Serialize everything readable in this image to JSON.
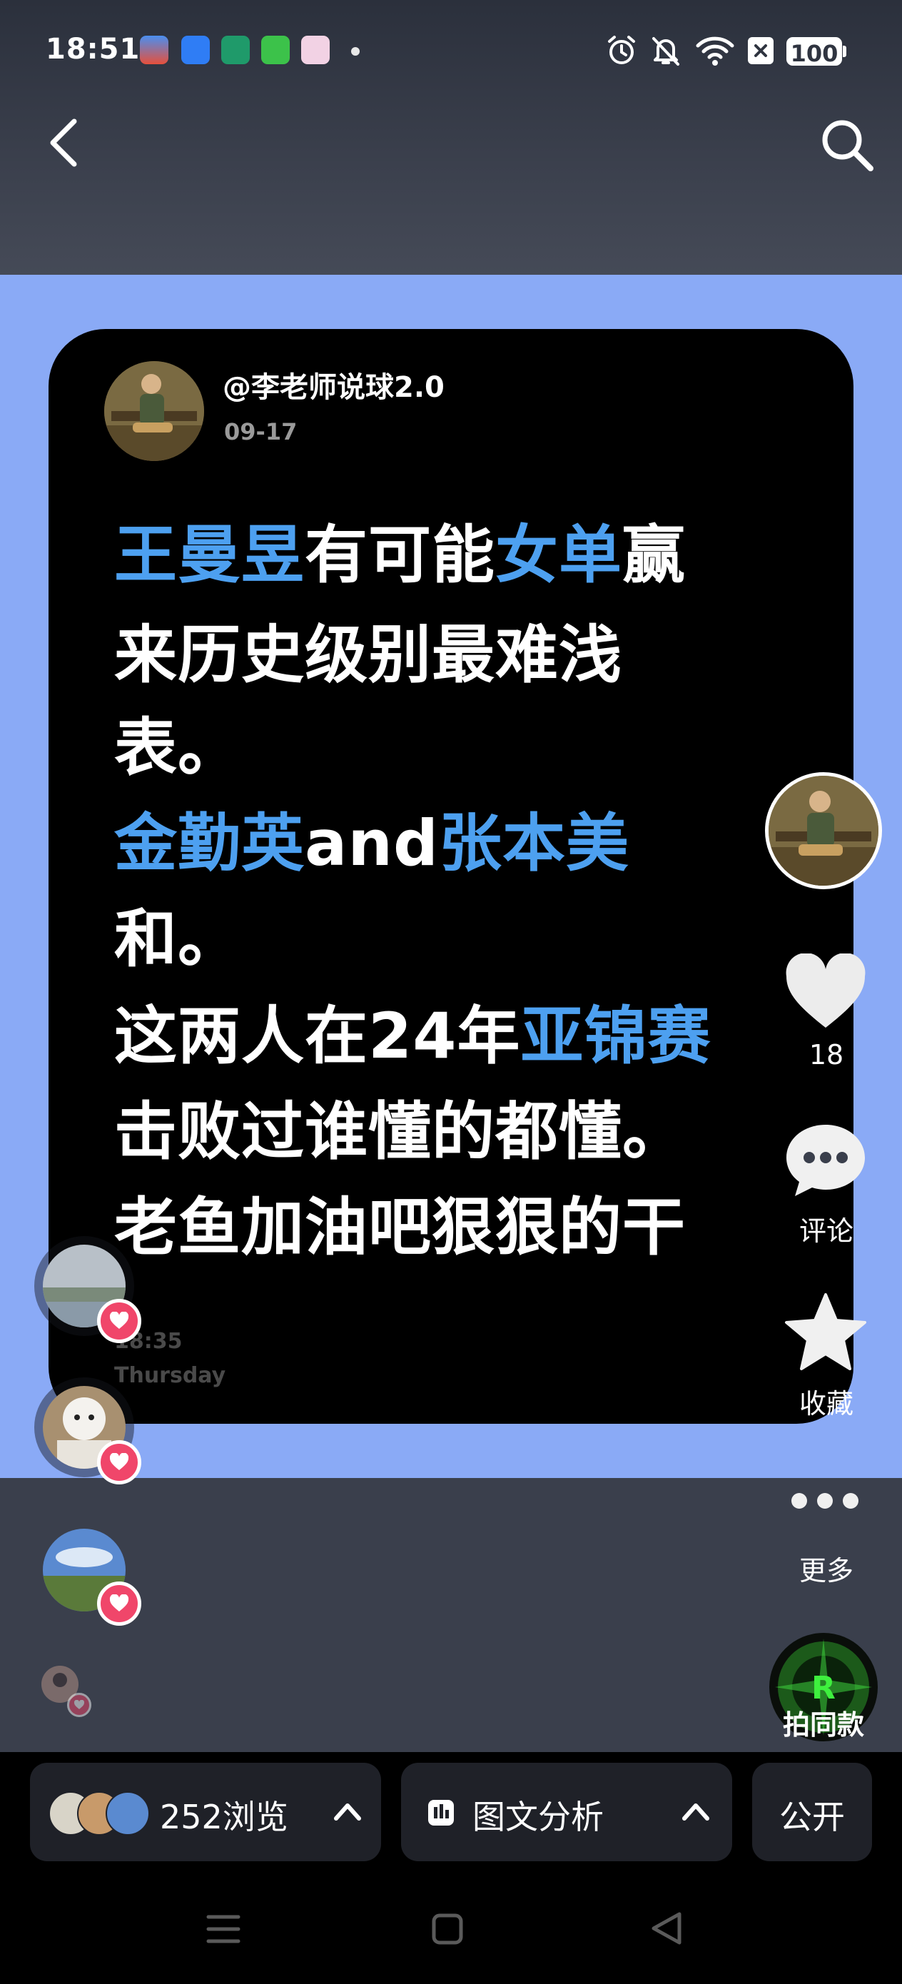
{
  "status_bar": {
    "time": "18:51",
    "battery": "100",
    "app_icons": [
      "app-icon-1",
      "app-icon-2",
      "app-icon-3",
      "app-icon-4",
      "app-icon-5"
    ],
    "system_icons": [
      "alarm-icon",
      "mute-icon",
      "wifi-icon",
      "sim-off-icon",
      "battery-icon"
    ]
  },
  "header": {
    "back_icon": "chevron-left-icon",
    "search_icon": "search-icon"
  },
  "post": {
    "author": "@李老师说球2.0",
    "date": "09-17",
    "lines": [
      [
        {
          "t": "王曼昱",
          "h": true
        },
        {
          "t": "有可能",
          "h": false
        },
        {
          "t": "女单",
          "h": true
        },
        {
          "t": "赢",
          "h": false
        }
      ],
      [
        {
          "t": "来历史级别最难浅",
          "h": false
        }
      ],
      [
        {
          "t": "表。",
          "h": false
        }
      ],
      [
        {
          "t": "金勤英",
          "h": true
        },
        {
          "t": "and",
          "h": false
        },
        {
          "t": "张本美",
          "h": true
        }
      ],
      [
        {
          "t": "和。",
          "h": false
        }
      ],
      [
        {
          "t": "这两人在24年",
          "h": false
        },
        {
          "t": "亚锦赛",
          "h": true
        }
      ],
      [
        {
          "t": "击败过谁懂的都懂。",
          "h": false
        }
      ],
      [
        {
          "t": "老鱼加油吧狠狠的干",
          "h": false
        }
      ]
    ],
    "card_time": "18:35",
    "card_day": "Thursday",
    "highlight_color": "#4da0f0",
    "background_color": "#8aaaf6"
  },
  "actions": {
    "like_count": "18",
    "comment_label": "评论",
    "favorite_label": "收藏",
    "more_label": "更多",
    "same_style_label": "拍同款"
  },
  "bottom": {
    "views": "252浏览",
    "analysis": "图文分析",
    "visibility": "公开"
  },
  "nav": [
    "menu-icon",
    "home-icon",
    "back-triangle-icon"
  ]
}
